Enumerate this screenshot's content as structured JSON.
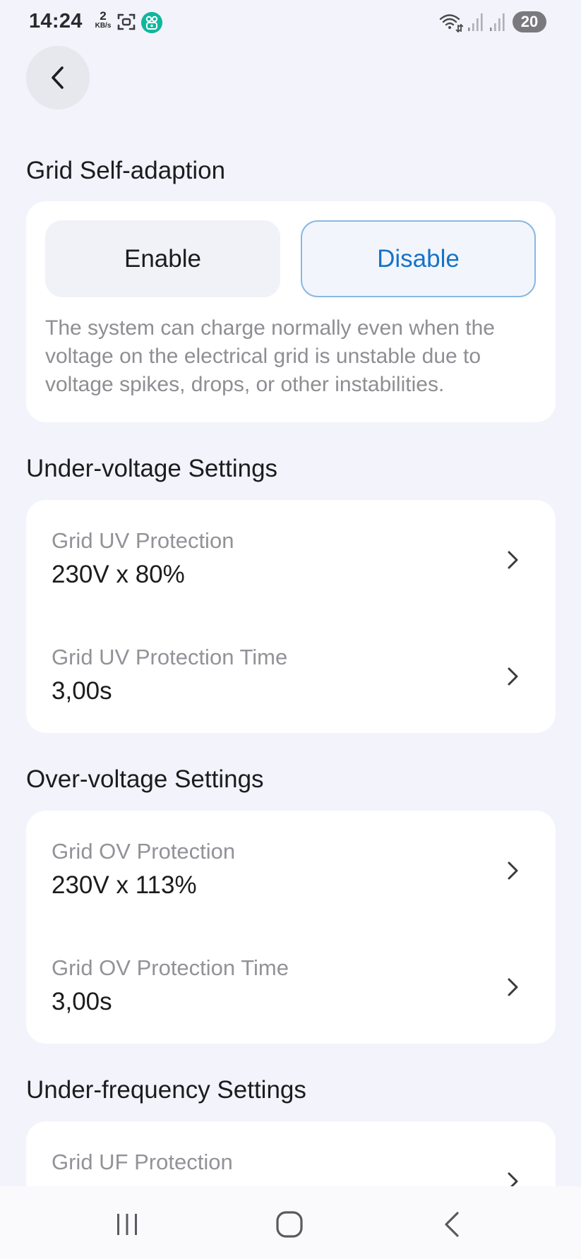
{
  "status_bar": {
    "time": "14:24",
    "net_speed_value": "2",
    "net_speed_unit": "KB/s",
    "battery_level": "20",
    "icons": [
      "screenshot-icon",
      "app-icon",
      "wifi-icon",
      "signal-icon",
      "signal-icon"
    ]
  },
  "grid_self_adaption": {
    "title": "Grid Self-adaption",
    "enable_label": "Enable",
    "disable_label": "Disable",
    "selected": "Disable",
    "description": "The system can charge normally even when the voltage on the electrical grid is unstable due to voltage spikes, drops, or other instabilities."
  },
  "under_voltage": {
    "title": "Under-voltage Settings",
    "rows": [
      {
        "label": "Grid UV Protection",
        "value": "230V x 80%"
      },
      {
        "label": "Grid UV Protection Time",
        "value": "3,00s"
      }
    ]
  },
  "over_voltage": {
    "title": "Over-voltage Settings",
    "rows": [
      {
        "label": "Grid OV Protection",
        "value": "230V x 113%"
      },
      {
        "label": "Grid OV Protection Time",
        "value": "3,00s"
      }
    ]
  },
  "under_frequency": {
    "title": "Under-frequency Settings",
    "rows": [
      {
        "label": "Grid UF Protection",
        "value": ""
      }
    ]
  },
  "colors": {
    "accent": "#1773c6",
    "background": "#f2f3fb",
    "card": "#ffffff"
  }
}
